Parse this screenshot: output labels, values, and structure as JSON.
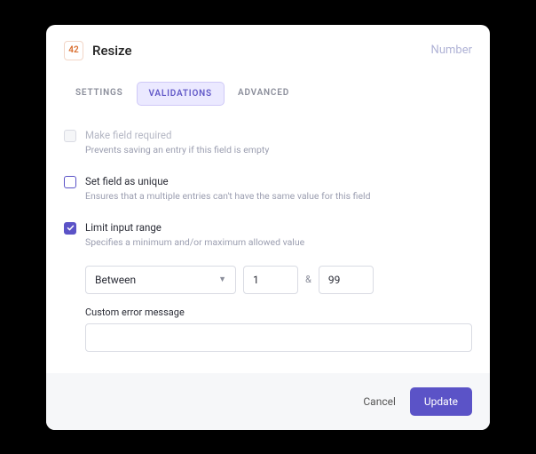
{
  "header": {
    "badge": "42",
    "title": "Resize",
    "type": "Number"
  },
  "tabs": {
    "settings": "SETTINGS",
    "validations": "VALIDATIONS",
    "advanced": "ADVANCED"
  },
  "options": {
    "required": {
      "title": "Make field required",
      "sub": "Prevents saving an entry if this field is empty"
    },
    "unique": {
      "title": "Set field as unique",
      "sub": "Ensures that a multiple entries can't have the same value for this field"
    },
    "range": {
      "title": "Limit input range",
      "sub": "Specifies a minimum and/or maximum allowed value",
      "mode": "Between",
      "ampersand": "&",
      "min": "1",
      "max": "99",
      "error_label": "Custom error message",
      "error_value": ""
    }
  },
  "footer": {
    "cancel": "Cancel",
    "update": "Update"
  }
}
